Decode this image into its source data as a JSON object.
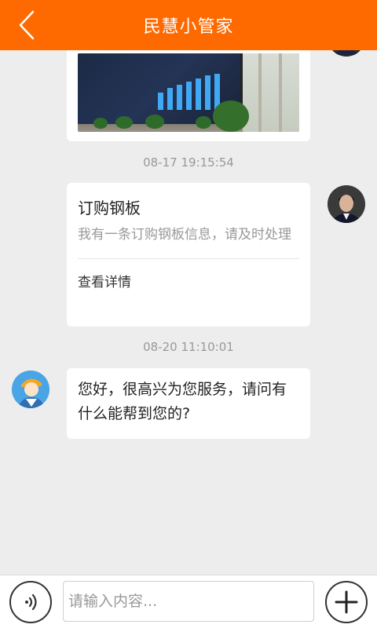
{
  "header": {
    "title": "民慧小管家",
    "back_icon": "chevron-left-icon",
    "background": "#ff6a00"
  },
  "messages": {
    "image_message": {
      "type": "image",
      "icon": "photo"
    },
    "timestamp_1": "08-17 19:15:54",
    "card_message": {
      "title": "订购钢板",
      "description": "我有一条订购钢板信息，请及时处理",
      "link_label": "查看详情"
    },
    "timestamp_2": "08-20 11:10:01",
    "bot_message": {
      "text": "您好，很高兴为您服务，请问有什么能帮到您的?"
    }
  },
  "input_bar": {
    "placeholder": "请输入内容...",
    "value": "",
    "voice_icon": "voice-icon",
    "plus_icon": "plus-icon"
  }
}
